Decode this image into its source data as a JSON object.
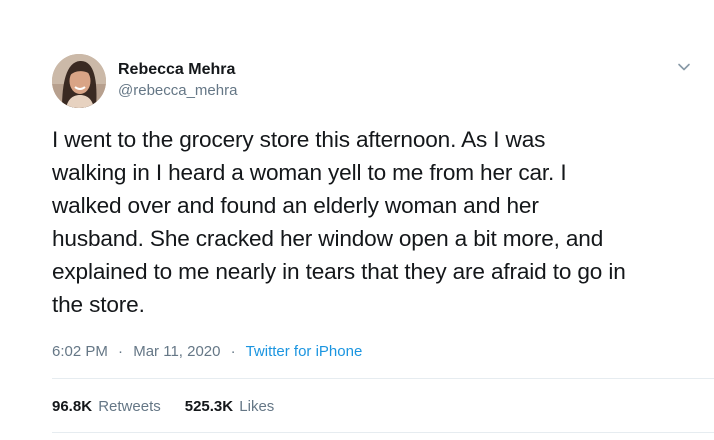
{
  "tweet": {
    "author": {
      "display_name": "Rebecca Mehra",
      "handle": "@rebecca_mehra",
      "avatar": "avatar-photo"
    },
    "text_lines": [
      "I went to the grocery store this afternoon. As I was",
      "walking in I heard a woman yell to me from her car. I",
      "walked over and found an elderly woman and her",
      "husband. She cracked her window open a bit more, and",
      "explained to me nearly in tears that they are afraid to go in",
      "the store."
    ],
    "time": "6:02 PM",
    "date": "Mar 11, 2020",
    "separator": "·",
    "source": "Twitter for iPhone",
    "stats": {
      "retweets_count": "96.8K",
      "retweets_label": "Retweets",
      "likes_count": "525.3K",
      "likes_label": "Likes"
    },
    "menu_icon": "chevron-down-icon"
  },
  "colors": {
    "text": "#14171a",
    "secondary": "#657786",
    "link": "#1b95e0",
    "divider": "#e6ecf0"
  }
}
